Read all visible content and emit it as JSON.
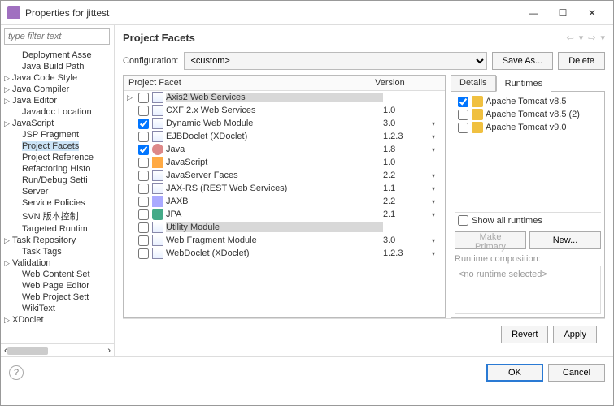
{
  "window": {
    "title": "Properties for jittest"
  },
  "filter_placeholder": "type filter text",
  "tree": [
    {
      "label": "Deployment Asse",
      "l": 1
    },
    {
      "label": "Java Build Path",
      "l": 1
    },
    {
      "label": "Java Code Style",
      "l": 0,
      "arrow": "▷"
    },
    {
      "label": "Java Compiler",
      "l": 0,
      "arrow": "▷"
    },
    {
      "label": "Java Editor",
      "l": 0,
      "arrow": "▷"
    },
    {
      "label": "Javadoc Location",
      "l": 1
    },
    {
      "label": "JavaScript",
      "l": 0,
      "arrow": "▷"
    },
    {
      "label": "JSP Fragment",
      "l": 1
    },
    {
      "label": "Project Facets",
      "l": 1,
      "sel": true
    },
    {
      "label": "Project Reference",
      "l": 1
    },
    {
      "label": "Refactoring Histo",
      "l": 1
    },
    {
      "label": "Run/Debug Setti",
      "l": 1
    },
    {
      "label": "Server",
      "l": 1
    },
    {
      "label": "Service Policies",
      "l": 1
    },
    {
      "label": "SVN 版本控制",
      "l": 1
    },
    {
      "label": "Targeted Runtim",
      "l": 1
    },
    {
      "label": "Task Repository",
      "l": 0,
      "arrow": "▷"
    },
    {
      "label": "Task Tags",
      "l": 1
    },
    {
      "label": "Validation",
      "l": 0,
      "arrow": "▷"
    },
    {
      "label": "Web Content Set",
      "l": 1
    },
    {
      "label": "Web Page Editor",
      "l": 1
    },
    {
      "label": "Web Project Sett",
      "l": 1
    },
    {
      "label": "WikiText",
      "l": 1
    },
    {
      "label": "XDoclet",
      "l": 0,
      "arrow": "▷"
    }
  ],
  "header": "Project Facets",
  "config_label": "Configuration:",
  "config_value": "<custom>",
  "save_as": "Save As...",
  "delete": "Delete",
  "col_facet": "Project Facet",
  "col_version": "Version",
  "facets": [
    {
      "name": "Axis2 Web Services",
      "ver": "",
      "chk": false,
      "arrow": "▷",
      "sel": true,
      "icon": "ic-page"
    },
    {
      "name": "CXF 2.x Web Services",
      "ver": "1.0",
      "chk": false,
      "icon": "ic-page"
    },
    {
      "name": "Dynamic Web Module",
      "ver": "3.0",
      "chk": true,
      "drop": true,
      "icon": "ic-page"
    },
    {
      "name": "EJBDoclet (XDoclet)",
      "ver": "1.2.3",
      "chk": false,
      "drop": true,
      "icon": "ic-page"
    },
    {
      "name": "Java",
      "ver": "1.8",
      "chk": true,
      "drop": true,
      "icon": "ic-java"
    },
    {
      "name": "JavaScript",
      "ver": "1.0",
      "chk": false,
      "icon": "ic-js"
    },
    {
      "name": "JavaServer Faces",
      "ver": "2.2",
      "chk": false,
      "drop": true,
      "icon": "ic-page"
    },
    {
      "name": "JAX-RS (REST Web Services)",
      "ver": "1.1",
      "chk": false,
      "drop": true,
      "icon": "ic-page"
    },
    {
      "name": "JAXB",
      "ver": "2.2",
      "chk": false,
      "drop": true,
      "icon": "ic-xml"
    },
    {
      "name": "JPA",
      "ver": "2.1",
      "chk": false,
      "drop": true,
      "icon": "ic-db"
    },
    {
      "name": "Utility Module",
      "ver": "",
      "chk": false,
      "sel": true,
      "icon": "ic-page"
    },
    {
      "name": "Web Fragment Module",
      "ver": "3.0",
      "chk": false,
      "drop": true,
      "icon": "ic-page"
    },
    {
      "name": "WebDoclet (XDoclet)",
      "ver": "1.2.3",
      "chk": false,
      "drop": true,
      "icon": "ic-page"
    }
  ],
  "tab_details": "Details",
  "tab_runtimes": "Runtimes",
  "runtimes": [
    {
      "name": "Apache Tomcat v8.5",
      "chk": true
    },
    {
      "name": "Apache Tomcat v8.5 (2)",
      "chk": false
    },
    {
      "name": "Apache Tomcat v9.0",
      "chk": false
    }
  ],
  "show_all": "Show all runtimes",
  "make_primary": "Make Primary",
  "new": "New...",
  "rt_comp": "Runtime composition:",
  "no_runtime": "<no runtime selected>",
  "revert": "Revert",
  "apply": "Apply",
  "ok": "OK",
  "cancel": "Cancel"
}
